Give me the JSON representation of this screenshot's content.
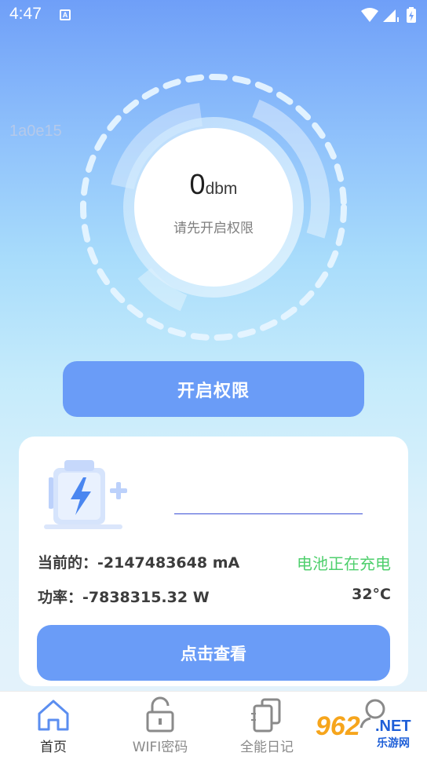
{
  "status_bar": {
    "time": "4:47",
    "notification_badge": "A",
    "icons": [
      "wifi-icon",
      "signal-icon",
      "battery-charging-icon"
    ]
  },
  "debug_text": "1a0e15",
  "gauge": {
    "value": "0",
    "unit": "dbm",
    "hint": "请先开启权限"
  },
  "primary_button": {
    "label": "开启权限"
  },
  "battery_card": {
    "current_label": "当前的：-2147483648 mA",
    "status": "电池正在充电",
    "power_label": "功率：-7838315.32 W",
    "temperature": "32°C",
    "view_button": "点击查看"
  },
  "tabs": [
    {
      "label": "首页",
      "icon": "home-icon",
      "active": true
    },
    {
      "label": "WIFI密码",
      "icon": "unlock-icon",
      "active": false
    },
    {
      "label": "全能日记",
      "icon": "diary-icon",
      "active": false
    },
    {
      "label": "",
      "icon": "search-icon",
      "active": false
    }
  ],
  "watermark": {
    "number": "962",
    "domain": ".NET",
    "cn": "乐游网"
  },
  "colors": {
    "accent": "#6a9cf7",
    "charging": "#4fcf6d",
    "home_icon": "#5b8ef0"
  }
}
